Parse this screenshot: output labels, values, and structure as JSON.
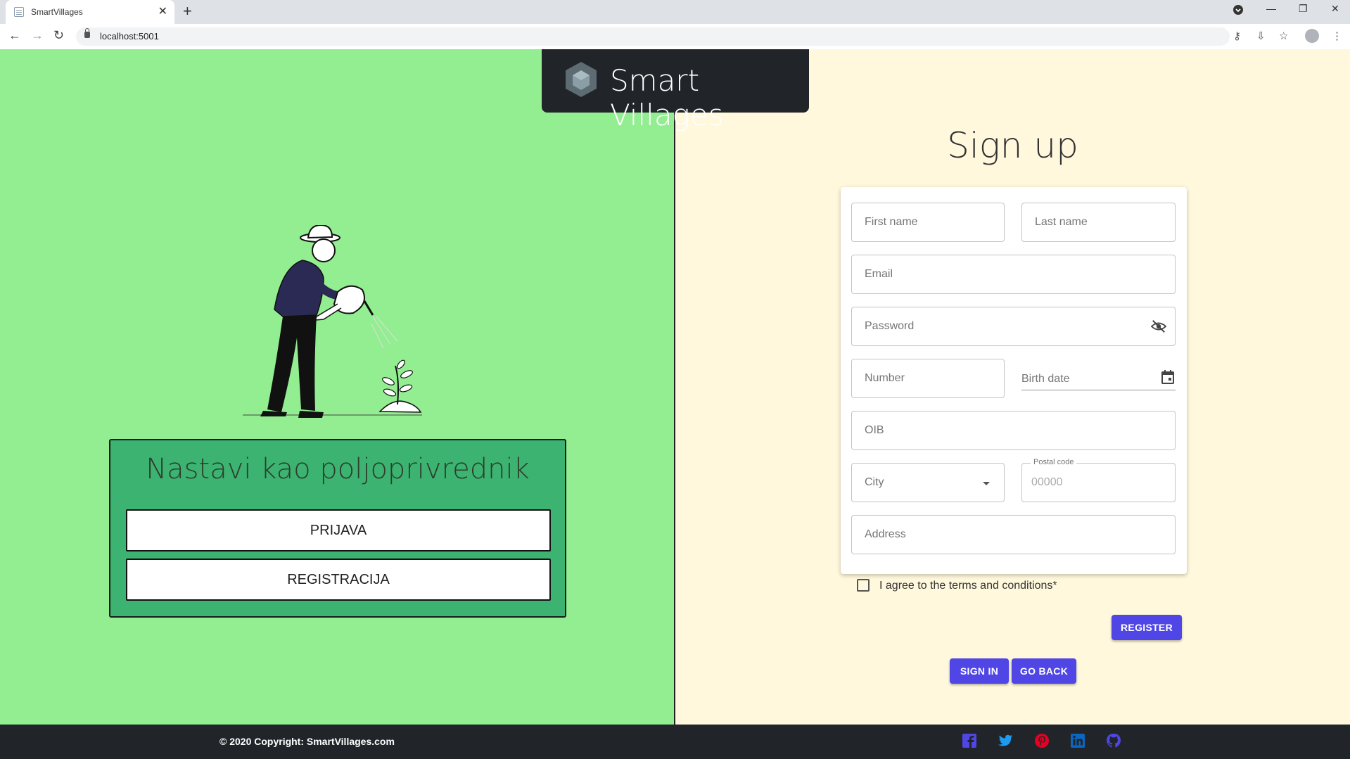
{
  "browser": {
    "tab_title": "SmartVillages",
    "url": "localhost:5001"
  },
  "brand": {
    "name": "Smart Villages"
  },
  "farmer_panel": {
    "title": "Nastavi kao poljoprivrednik",
    "login_label": "PRIJAVA",
    "register_label": "REGISTRACIJA"
  },
  "signup": {
    "title": "Sign up",
    "first_name": "First name",
    "last_name": "Last name",
    "email": "Email",
    "password": "Password",
    "number": "Number",
    "birth_date": "Birth date",
    "oib": "OIB",
    "city": "City",
    "postal_code_label": "Postal code",
    "postal_code_placeholder": "00000",
    "address": "Address",
    "terms": "I agree to the terms and conditions*",
    "register": "REGISTER",
    "sign_in": "SIGN IN",
    "go_back": "GO BACK"
  },
  "footer": {
    "copyright": "© 2020 Copyright: SmartVillages.com",
    "social": [
      "facebook-icon",
      "twitter-icon",
      "pinterest-icon",
      "linkedin-icon",
      "github-icon"
    ]
  },
  "colors": {
    "left_bg": "#92ee90",
    "right_bg": "#fff8dc",
    "panel_bg": "#3cb371",
    "button": "#4f46e5",
    "dark": "#212529"
  }
}
